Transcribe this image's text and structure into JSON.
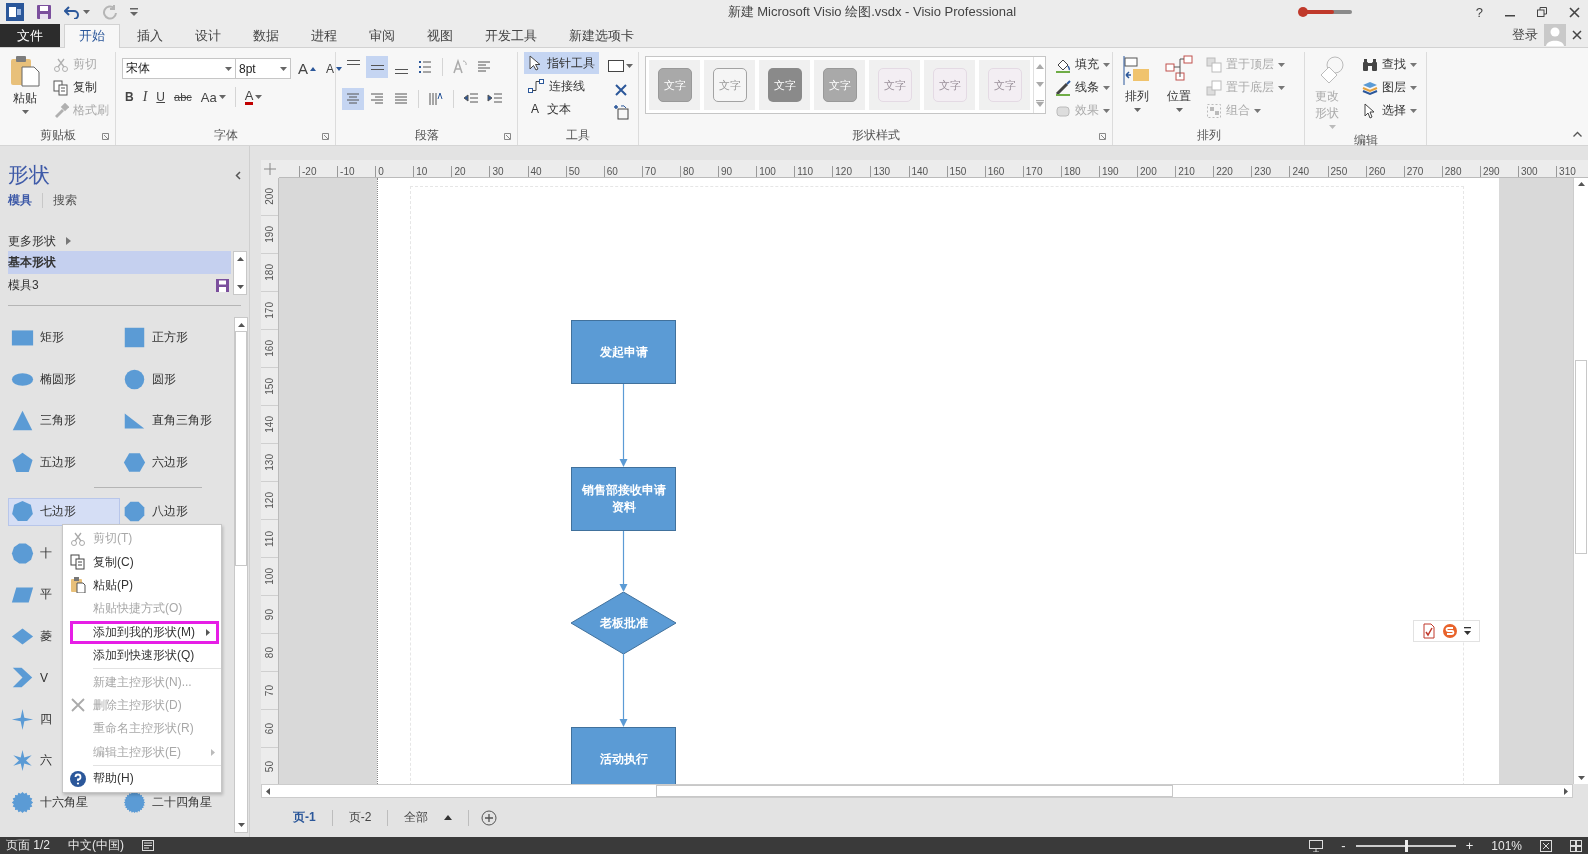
{
  "title_bar": {
    "title": "新建 Microsoft Visio 绘图.vsdx - Visio Professional",
    "help": "?"
  },
  "tabs": [
    {
      "label": "文件",
      "kind": "file",
      "selected": false
    },
    {
      "label": "开始",
      "kind": "tab",
      "selected": true
    },
    {
      "label": "插入",
      "kind": "tab",
      "selected": false
    },
    {
      "label": "设计",
      "kind": "tab",
      "selected": false
    },
    {
      "label": "数据",
      "kind": "tab",
      "selected": false
    },
    {
      "label": "进程",
      "kind": "tab",
      "selected": false
    },
    {
      "label": "审阅",
      "kind": "tab",
      "selected": false
    },
    {
      "label": "视图",
      "kind": "tab",
      "selected": false
    },
    {
      "label": "开发工具",
      "kind": "tab",
      "selected": false
    },
    {
      "label": "新建选项卡",
      "kind": "tab",
      "selected": false
    }
  ],
  "account": {
    "label": "登录"
  },
  "ribbon": [
    {
      "kind": "clipboard",
      "label": "剪贴板",
      "paste": "粘贴",
      "items": [
        {
          "label": "剪切",
          "disabled": true
        },
        {
          "label": "复制",
          "disabled": false
        },
        {
          "label": "格式刷",
          "disabled": true
        }
      ]
    },
    {
      "kind": "font",
      "label": "字体",
      "font": "宋体",
      "size": "8pt",
      "grow": "A",
      "shrink": "A",
      "styles": [
        "B",
        "I",
        "U",
        "abc",
        "Aa"
      ],
      "color_button": "A"
    },
    {
      "kind": "paragraph",
      "label": "段落",
      "buttons": [
        {
          "selected": false
        },
        {
          "selected": true
        },
        {
          "selected": false
        },
        {
          "selected": false
        },
        {
          "selected": false
        },
        {
          "selected": false
        },
        {
          "selected": true
        },
        {
          "selected": false
        },
        {
          "selected": false
        },
        {
          "selected": false
        },
        {
          "selected": false
        },
        {
          "selected": false
        }
      ]
    },
    {
      "kind": "tools",
      "label": "工具",
      "glyph": "A",
      "items": [
        {
          "label": "指针工具",
          "selected": true
        },
        {
          "label": "连接线",
          "selected": false
        },
        {
          "label": "文本",
          "selected": false
        }
      ]
    },
    {
      "kind": "shape_styles",
      "label": "形状样式",
      "swatches": [
        {
          "label": "文字",
          "kind": "gray"
        },
        {
          "label": "文字",
          "kind": "outline"
        },
        {
          "label": "文字",
          "kind": "dark"
        },
        {
          "label": "文字",
          "kind": "gray"
        },
        {
          "label": "文字",
          "kind": "faint"
        },
        {
          "label": "文字",
          "kind": "faint"
        },
        {
          "label": "文字",
          "kind": "faint"
        }
      ],
      "items": [
        {
          "label": "填充",
          "disabled": false
        },
        {
          "label": "线条",
          "disabled": false
        },
        {
          "label": "效果",
          "disabled": true
        }
      ]
    },
    {
      "kind": "arrange",
      "label": "排列",
      "big": [
        {
          "label": "排列"
        },
        {
          "label": "位置"
        }
      ],
      "items": [
        {
          "label": "置于顶层",
          "disabled": true
        },
        {
          "label": "置于底层",
          "disabled": true
        },
        {
          "label": "组合",
          "disabled": true
        }
      ]
    },
    {
      "kind": "edit",
      "label": "编辑",
      "big": {
        "label": "更改形状",
        "disabled": true
      },
      "items": [
        {
          "label": "查找"
        },
        {
          "label": "图层"
        },
        {
          "label": "选择"
        }
      ]
    }
  ],
  "shapes_panel": {
    "title": "形状",
    "tabs": [
      {
        "label": "模具",
        "selected": true
      },
      {
        "label": "搜索",
        "selected": false
      }
    ],
    "more": "更多形状",
    "stencils": [
      {
        "label": "基本形状",
        "selected": true
      },
      {
        "label": "模具3",
        "selected": false
      }
    ],
    "sections": [
      {
        "rows": [
          {
            "left": {
              "label": "矩形",
              "kind": "rectangle",
              "selected": false
            },
            "right": {
              "label": "正方形",
              "kind": "square",
              "selected": false
            }
          },
          {
            "left": {
              "label": "椭圆形",
              "kind": "ellipse",
              "selected": false
            },
            "right": {
              "label": "圆形",
              "kind": "circle",
              "selected": false
            }
          },
          {
            "left": {
              "label": "三角形",
              "kind": "triangle",
              "selected": false
            },
            "right": {
              "label": "直角三角形",
              "kind": "right_triangle",
              "selected": false
            }
          },
          {
            "left": {
              "label": "五边形",
              "kind": "pentagon",
              "selected": false
            },
            "right": {
              "label": "六边形",
              "kind": "hexagon",
              "selected": false
            }
          }
        ]
      },
      {
        "rows": [
          {
            "left": {
              "label": "七边形",
              "kind": "heptagon",
              "selected": true
            },
            "right": {
              "label": "八边形",
              "kind": "octagon",
              "selected": false
            }
          },
          {
            "left": {
              "label": "十",
              "kind": "decagon",
              "selected": false
            }
          },
          {
            "left": {
              "label": "平",
              "kind": "parallelogram",
              "selected": false
            }
          },
          {
            "left": {
              "label": "菱",
              "kind": "diamond",
              "selected": false
            }
          },
          {
            "left": {
              "label": "V",
              "kind": "chevron",
              "selected": false
            }
          },
          {
            "left": {
              "label": "四",
              "kind": "star4",
              "selected": false
            }
          },
          {
            "left": {
              "label": "六",
              "kind": "star6",
              "selected": false
            }
          },
          {
            "left": {
              "label": "十六角星",
              "kind": "star16",
              "selected": false
            },
            "right": {
              "label": "二十四角星",
              "kind": "star24",
              "selected": false
            }
          }
        ]
      }
    ]
  },
  "context_menu": {
    "items": [
      {
        "label": "剪切(T)",
        "disabled": true
      },
      {
        "label": "复制(C)",
        "disabled": false
      },
      {
        "label": "粘贴(P)",
        "disabled": false
      },
      {
        "label": "粘贴快捷方式(O)",
        "disabled": true
      },
      {
        "label": "添加到我的形状(M)",
        "disabled": false,
        "submenu": true,
        "highlighted": true
      },
      {
        "label": "添加到快速形状(Q)",
        "disabled": false
      },
      {
        "label": "新建主控形状(N)...",
        "disabled": true,
        "separator_before": true
      },
      {
        "label": "删除主控形状(D)",
        "disabled": true
      },
      {
        "label": "重命名主控形状(R)",
        "disabled": true
      },
      {
        "label": "编辑主控形状(E)",
        "disabled": true,
        "submenu": true
      },
      {
        "label": "帮助(H)",
        "disabled": false,
        "separator_before": true
      }
    ]
  },
  "ruler_h": [
    "-20",
    "-10",
    "0",
    "10",
    "20",
    "30",
    "40",
    "50",
    "60",
    "70",
    "80",
    "90",
    "100",
    "110",
    "120",
    "130",
    "140",
    "150",
    "160",
    "170",
    "180",
    "190",
    "200",
    "210",
    "220",
    "230",
    "240",
    "250",
    "260",
    "270",
    "280",
    "290",
    "300",
    "310"
  ],
  "ruler_v": [
    "200",
    "190",
    "180",
    "170",
    "160",
    "150",
    "140",
    "130",
    "120",
    "110",
    "100",
    "90",
    "80",
    "70",
    "60",
    "50"
  ],
  "diagram": {
    "nodes": [
      {
        "label": "发起申请",
        "kind": "process"
      },
      {
        "label": "销售部接收申请资料",
        "kind": "process"
      },
      {
        "label": "老板批准",
        "kind": "decision"
      },
      {
        "label": "活动执行",
        "kind": "process"
      }
    ]
  },
  "page_tabs": [
    {
      "label": "页-1",
      "kind": "page",
      "selected": true
    },
    {
      "label": "页-2",
      "kind": "page",
      "selected": false
    },
    {
      "label": "全部",
      "kind": "menu",
      "selected": false
    }
  ],
  "status_bar": {
    "page": "页面 1/2",
    "language": "中文(中国)",
    "zoom_out": "-",
    "zoom_in": "+",
    "zoom": "101%",
    "zoom_slider": {
      "level": 0.5
    }
  }
}
